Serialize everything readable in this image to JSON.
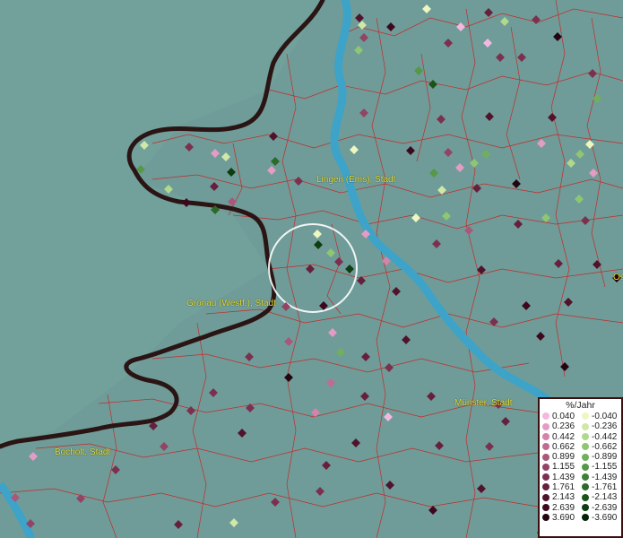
{
  "map": {
    "colors": {
      "background": "#6f9c98",
      "border": "#2a1414",
      "river": "#3da3c8",
      "district_line": "#c42a2a",
      "label": "#e8e23a",
      "highlight_ring": "#ffffff"
    },
    "city_labels": [
      {
        "name": "Lingen (Ems), Stadt"
      },
      {
        "name": "Gronau (Westf.), Stadt"
      },
      {
        "name": "Münster, Stadt"
      },
      {
        "name": "Bocholt, Stadt"
      },
      {
        "name": "Os"
      }
    ],
    "legend": {
      "title": "%/Jahr",
      "positive": [
        {
          "label": "0.040",
          "color": "#f4b8df"
        },
        {
          "label": "0.236",
          "color": "#e59cc4"
        },
        {
          "label": "0.442",
          "color": "#d483ab"
        },
        {
          "label": "0.662",
          "color": "#c06c92"
        },
        {
          "label": "0.899",
          "color": "#a9587b"
        },
        {
          "label": "1.155",
          "color": "#914464"
        },
        {
          "label": "1.439",
          "color": "#7c3050"
        },
        {
          "label": "1.761",
          "color": "#661f3d"
        },
        {
          "label": "2.143",
          "color": "#51122c"
        },
        {
          "label": "2.639",
          "color": "#3d081e"
        },
        {
          "label": "3.690",
          "color": "#260310"
        }
      ],
      "negative": [
        {
          "label": "-0.040",
          "color": "#eef7c0"
        },
        {
          "label": "-0.236",
          "color": "#cfe8a6"
        },
        {
          "label": "-0.442",
          "color": "#b0d98c"
        },
        {
          "label": "-0.662",
          "color": "#8fc672"
        },
        {
          "label": "-0.899",
          "color": "#70b05c"
        },
        {
          "label": "-1.155",
          "color": "#559848"
        },
        {
          "label": "-1.439",
          "color": "#3e8037"
        },
        {
          "label": "-1.761",
          "color": "#2b6a28"
        },
        {
          "label": "-2.143",
          "color": "#1c531b"
        },
        {
          "label": "-2.639",
          "color": "#0f3c10"
        },
        {
          "label": "-3.690",
          "color": "#042306"
        }
      ]
    }
  }
}
